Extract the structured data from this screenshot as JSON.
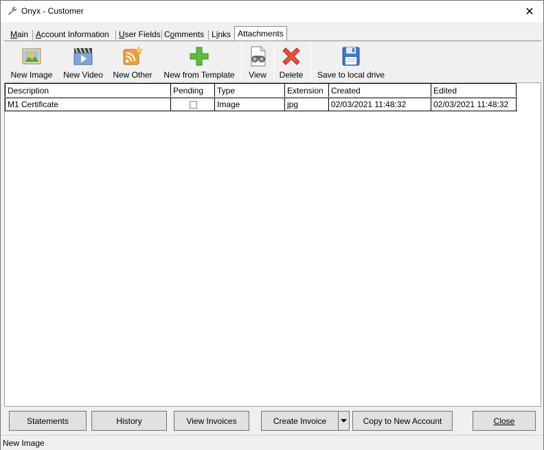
{
  "window": {
    "title": "Onyx - Customer",
    "close_glyph": "✕"
  },
  "tabs": [
    {
      "label": "Main",
      "mnemonic": "M",
      "rest": "ain"
    },
    {
      "label": "Account Information",
      "mnemonic": "A",
      "rest": "ccount Information"
    },
    {
      "label": "User Fields",
      "mnemonic": "U",
      "rest": "ser Fields"
    },
    {
      "label": "Comments",
      "pre": "C",
      "mnemonic": "o",
      "rest": "mments"
    },
    {
      "label": "Links",
      "pre": "L",
      "mnemonic": "i",
      "rest": "nks"
    },
    {
      "label": "Attachments",
      "active": true
    }
  ],
  "toolbar": {
    "new_image": {
      "label": "New Image",
      "icon": "image-icon"
    },
    "new_video": {
      "label": "New Video",
      "icon": "video-icon"
    },
    "new_other": {
      "label": "New Other",
      "icon": "rss-new-icon"
    },
    "new_from_template": {
      "label": "New from Template",
      "icon": "plus-icon"
    },
    "view": {
      "label": "View",
      "icon": "binoculars-document-icon"
    },
    "delete": {
      "label": "Delete",
      "icon": "red-x-icon"
    },
    "save_local": {
      "label": "Save to local drive",
      "icon": "floppy-disk-icon"
    }
  },
  "grid": {
    "columns": [
      "Description",
      "Pending",
      "Type",
      "Extension",
      "Created",
      "Edited"
    ],
    "rows": [
      {
        "description": "M1 Certificate",
        "pending": false,
        "type": "Image",
        "extension": "jpg",
        "created": "02/03/2021 11:48:32",
        "edited": "02/03/2021 11:48:32"
      }
    ]
  },
  "buttons": {
    "statements": "Statements",
    "history": "History",
    "view_invoices": "View Invoices",
    "create_invoice": "Create Invoice",
    "copy_to_new_account": "Copy to New Account",
    "close": "Close"
  },
  "status_bar": {
    "text": "New Image"
  }
}
